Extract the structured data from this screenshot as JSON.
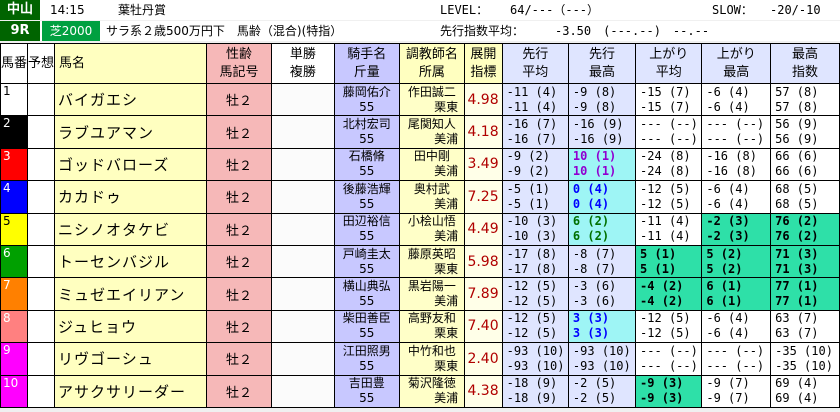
{
  "header": {
    "course": "中山",
    "time": "14:15",
    "race_title": "葉牡丹賞",
    "level_label": "LEVEL：",
    "level_value": "64/---（---）",
    "slow_label": "SLOW：",
    "slow_value": "-20/-10",
    "race_no": "9R",
    "surface": "芝2000",
    "conditions": "サラ系２歳500万円下　馬齢（混合)(特指）",
    "pace_label": "先行指数平均：",
    "pace_value": "-3.50　(---.--)　--.--"
  },
  "columns": [
    "馬番",
    "予想",
    "馬名",
    "性齢\n馬記号",
    "単勝\n複勝",
    "騎手名\n斤量",
    "調教師名\n所属",
    "展開\n指標",
    "先行\n平均",
    "先行\n最高",
    "上がり\n平均",
    "上がり\n最高",
    "最高\n指数"
  ],
  "horses": [
    {
      "no": "1",
      "no_bg": "#ffffff",
      "no_fg": "#000000",
      "name": "バイガエシ",
      "sex": "牡２",
      "jockey": "藤岡佑介",
      "weight": "55",
      "trainer": "作田誠二",
      "dept": "栗東",
      "idx": "4.98",
      "s1a": "-11 (4)",
      "s1b": "-11 (4)",
      "s2a": "-9 (8)",
      "s2b": "-9 (8)",
      "s3a": "-15 (7)",
      "s3b": "-15 (7)",
      "s4a": "-6 (4)",
      "s4b": "-6 (4)",
      "s5a": "57 (8)",
      "s5b": "57 (8)"
    },
    {
      "no": "2",
      "no_bg": "#000000",
      "no_fg": "#ffffff",
      "name": "ラブユアマン",
      "sex": "牡２",
      "jockey": "北村宏司",
      "weight": "55",
      "trainer": "尾関知人",
      "dept": "美浦",
      "idx": "4.18",
      "s1a": "-16 (7)",
      "s1b": "-16 (7)",
      "s2a": "-16 (9)",
      "s2b": "-16 (9)",
      "s3a": "--- (--)",
      "s3b": "--- (--)",
      "s4a": "--- (--)",
      "s4b": "--- (--)",
      "s5a": "56 (9)",
      "s5b": "56 (9)"
    },
    {
      "no": "3",
      "no_bg": "#ff0000",
      "no_fg": "#ffffff",
      "name": "ゴッドバローズ",
      "sex": "牡２",
      "jockey": "石橋脩",
      "weight": "55",
      "trainer": "田中剛",
      "dept": "美浦",
      "idx": "3.49",
      "s1a": "-9 (2)",
      "s1b": "-9 (2)",
      "s2a": "10 (1)",
      "s2b": "10 (1)",
      "s3a": "-24 (8)",
      "s3b": "-24 (8)",
      "s4a": "-16 (8)",
      "s4b": "-16 (8)",
      "s5a": "66 (6)",
      "s5b": "66 (6)"
    },
    {
      "no": "4",
      "no_bg": "#0000ff",
      "no_fg": "#ffffff",
      "name": "カカドゥ",
      "sex": "牡２",
      "jockey": "後藤浩輝",
      "weight": "55",
      "trainer": "奥村武",
      "dept": "美浦",
      "idx": "7.25",
      "s1a": "-5 (1)",
      "s1b": "-5 (1)",
      "s2a": "0 (4)",
      "s2b": "0 (4)",
      "s3a": "-12 (5)",
      "s3b": "-12 (5)",
      "s4a": "-6 (4)",
      "s4b": "-6 (4)",
      "s5a": "68 (5)",
      "s5b": "68 (5)"
    },
    {
      "no": "5",
      "no_bg": "#ffff00",
      "no_fg": "#000000",
      "name": "ニシノオタケビ",
      "sex": "牡２",
      "jockey": "田辺裕信",
      "weight": "55",
      "trainer": "小桧山悟",
      "dept": "美浦",
      "idx": "4.49",
      "s1a": "-10 (3)",
      "s1b": "-10 (3)",
      "s2a": "6 (2)",
      "s2b": "6 (2)",
      "s3a": "-11 (4)",
      "s3b": "-11 (4)",
      "s4a": "-2 (3)",
      "s4b": "-2 (3)",
      "s5a": "76 (2)",
      "s5b": "76 (2)"
    },
    {
      "no": "6",
      "no_bg": "#00a000",
      "no_fg": "#ffffff",
      "name": "トーセンバジル",
      "sex": "牡２",
      "jockey": "戸崎圭太",
      "weight": "55",
      "trainer": "藤原英昭",
      "dept": "栗東",
      "idx": "5.98",
      "s1a": "-17 (8)",
      "s1b": "-17 (8)",
      "s2a": "-8 (7)",
      "s2b": "-8 (7)",
      "s3a": "5 (1)",
      "s3b": "5 (1)",
      "s4a": "5 (2)",
      "s4b": "5 (2)",
      "s5a": "71 (3)",
      "s5b": "71 (3)"
    },
    {
      "no": "7",
      "no_bg": "#ff8000",
      "no_fg": "#ffffff",
      "name": "ミュゼエイリアン",
      "sex": "牡２",
      "jockey": "横山典弘",
      "weight": "55",
      "trainer": "黒岩陽一",
      "dept": "美浦",
      "idx": "7.89",
      "s1a": "-12 (5)",
      "s1b": "-12 (5)",
      "s2a": "-3 (6)",
      "s2b": "-3 (6)",
      "s3a": "-4 (2)",
      "s3b": "-4 (2)",
      "s4a": "6 (1)",
      "s4b": "6 (1)",
      "s5a": "77 (1)",
      "s5b": "77 (1)"
    },
    {
      "no": "8",
      "no_bg": "#ff8080",
      "no_fg": "#ffffff",
      "name": "ジュヒョウ",
      "sex": "牡２",
      "jockey": "柴田善臣",
      "weight": "55",
      "trainer": "高野友和",
      "dept": "栗東",
      "idx": "7.40",
      "s1a": "-12 (5)",
      "s1b": "-12 (5)",
      "s2a": "3 (3)",
      "s2b": "3 (3)",
      "s3a": "-12 (5)",
      "s3b": "-12 (5)",
      "s4a": "-6 (4)",
      "s4b": "-6 (4)",
      "s5a": "63 (7)",
      "s5b": "63 (7)"
    },
    {
      "no": "9",
      "no_bg": "#ff00ff",
      "no_fg": "#ffffff",
      "name": "リヴゴーシュ",
      "sex": "牡２",
      "jockey": "江田照男",
      "weight": "55",
      "trainer": "中竹和也",
      "dept": "栗東",
      "idx": "2.40",
      "s1a": "-93 (10)",
      "s1b": "-93 (10)",
      "s2a": "-93 (10)",
      "s2b": "-93 (10)",
      "s3a": "--- (--)",
      "s3b": "--- (--)",
      "s4a": "--- (--)",
      "s4b": "--- (--)",
      "s5a": "-35 (10)",
      "s5b": "-35 (10)"
    },
    {
      "no": "10",
      "no_bg": "#ff00ff",
      "no_fg": "#ffffff",
      "name": "アサクサリーダー",
      "sex": "牡２",
      "jockey": "吉田豊",
      "weight": "55",
      "trainer": "菊沢隆徳",
      "dept": "美浦",
      "idx": "4.38",
      "s1a": "-18 (9)",
      "s1b": "-18 (9)",
      "s2a": "-2 (5)",
      "s2b": "-2 (5)",
      "s3a": "-9 (3)",
      "s3b": "-9 (3)",
      "s4a": "-9 (7)",
      "s4b": "-9 (7)",
      "s5a": "69 (4)",
      "s5b": "69 (4)"
    }
  ],
  "highlights": {
    "s2_purple_rows": [
      2
    ],
    "s2_blue_rows": [
      3,
      7
    ],
    "s2_green_rows": [
      4
    ],
    "s3_cyan_rows": [
      5,
      6,
      9
    ],
    "s4_green_rows": [
      4,
      5,
      6
    ],
    "s5_green_rows": [
      4,
      5,
      6
    ]
  }
}
